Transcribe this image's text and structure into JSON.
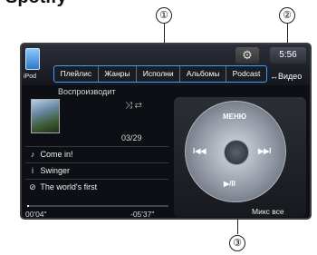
{
  "heading": "Spotify",
  "callouts": {
    "one": "①",
    "two": "②",
    "three": "③"
  },
  "topbar": {
    "source_label": "iPod",
    "tabs": [
      "Плейлис",
      "Жанры",
      "Исполни",
      "Альбомы",
      "Podcast"
    ],
    "gear_icon": "gear-icon",
    "clock": "5:56",
    "video_label": "↔Видео"
  },
  "now_playing": {
    "header": "Воспроизводит",
    "mode_icons": "⤨ ⇄",
    "track_counter": "03/29",
    "song": "Come in!",
    "artist": "Swinger",
    "album": "The world's first",
    "elapsed": "00'04\"",
    "remaining": "-05'37\"",
    "progress_fraction": 0.01
  },
  "controls": {
    "menu_label": "МЕНЮ",
    "prev_label": "I◀◀",
    "next_label": "▶▶I",
    "play_pause_label": "▶/II",
    "shuffle_label": "Микс все"
  },
  "colors": {
    "tab_border": "#3aa0ff",
    "screen_bg": "#0d0f14"
  }
}
